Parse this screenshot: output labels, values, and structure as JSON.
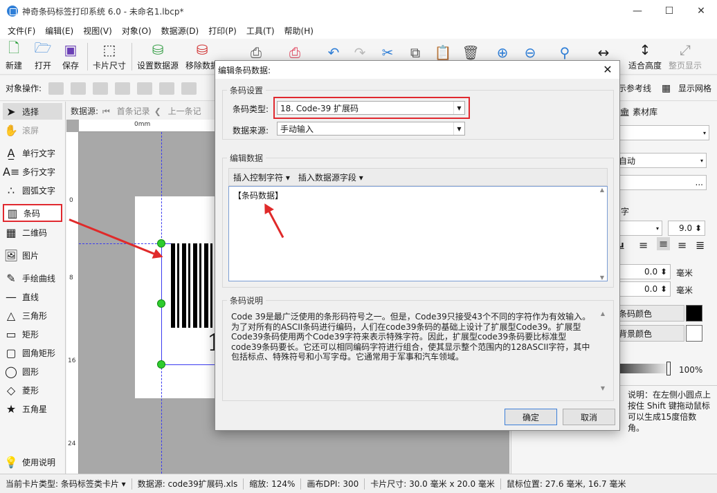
{
  "window": {
    "title": "神奇条码标签打印系统 6.0 - 未命名1.lbcp*",
    "minimize": "—",
    "maximize": "☐",
    "close": "✕"
  },
  "menu": [
    "文件(F)",
    "编辑(E)",
    "视图(V)",
    "对象(O)",
    "数据源(D)",
    "打印(P)",
    "工具(T)",
    "帮助(H)"
  ],
  "toolbar": {
    "new": "新建",
    "open": "打开",
    "save": "保存",
    "card_size": "卡片尺寸",
    "set_datasource": "设置数据源",
    "remove_datasource": "移除数据",
    "fit_height": "适合高度",
    "full_page": "整页显示"
  },
  "objbar": {
    "label": "对象操作:",
    "show_guides": "示参考线",
    "show_grid": "显示网格"
  },
  "tools": {
    "select": "选择",
    "scroll": "滚屏",
    "single_text": "单行文字",
    "multi_text": "多行文字",
    "arc_text": "圆弧文字",
    "barcode": "条码",
    "qrcode": "二维码",
    "image": "图片",
    "freehand": "手绘曲线",
    "line": "直线",
    "triangle": "三角形",
    "rect": "矩形",
    "rounded_rect": "圆角矩形",
    "circle": "圆形",
    "diamond": "菱形",
    "star": "五角星",
    "help": "使用说明"
  },
  "datasrc": {
    "label": "数据源:",
    "first": "首条记录",
    "prev": "上一条记"
  },
  "ruler": {
    "h0": "0mm",
    "v0": "0",
    "v8": "8",
    "v16": "16",
    "v24": "24"
  },
  "canvas": {
    "barcode_digit": "1"
  },
  "right": {
    "tab_material": "素材库",
    "auto": "自动",
    "ellipsis": "...",
    "zi": "字",
    "font_size": "9.0",
    "val1": "0.0",
    "val2": "0.0",
    "unit1": "毫米",
    "unit2": "毫米",
    "barcode_color": "条码颜色",
    "bg_color": "背景颜色",
    "opacity": "100%",
    "hint": "说明：在左侧小圆点上按住 Shift 键拖动鼠标可以生成15度倍数角。",
    "colors": {
      "barcode": "#000000",
      "background": "#ffffff"
    }
  },
  "dialog": {
    "title": "编辑条码数据:",
    "close": "✕",
    "settings_group": "条码设置",
    "type_label": "条码类型:",
    "type_value": "18. Code-39 扩展码",
    "source_label": "数据来源:",
    "source_value": "手动输入",
    "edit_group": "编辑数据",
    "insert_control": "插入控制字符",
    "insert_field": "插入数据源字段",
    "editor_text": "【条码数据】",
    "desc_group": "条码说明",
    "desc_text": "Code 39是最广泛使用的条形码符号之一。但是，Code39只接受43个不同的字符作为有效输入。为了对所有的ASCII条码进行编码，人们在code39条码的基础上设计了扩展型Code39。扩展型Code39条码使用两个Code39字符来表示特殊字符。因此，扩展型code39条码要比标准型code39条码要长。它还可以相同编码字符进行组合，使其显示整个范围内的128ASCII字符，其中包括标点、特殊符号和小写字母。它通常用于军事和汽车领域。",
    "ok": "确定",
    "cancel": "取消"
  },
  "status": {
    "card_type": "当前卡片类型:  条码标签类卡片 ▾",
    "datasource": "数据源:  code39扩展码.xls",
    "zoom": "缩放:  124%",
    "dpi": "画布DPI:  300",
    "card_size": "卡片尺寸:  30.0 毫米 x 20.0 毫米",
    "mouse_pos": "鼠标位置:  27.6 毫米,  16.7 毫米"
  },
  "accent": {
    "highlight": "#e0282e",
    "guide": "#3a3af0",
    "handle": "#2ecc2e"
  }
}
